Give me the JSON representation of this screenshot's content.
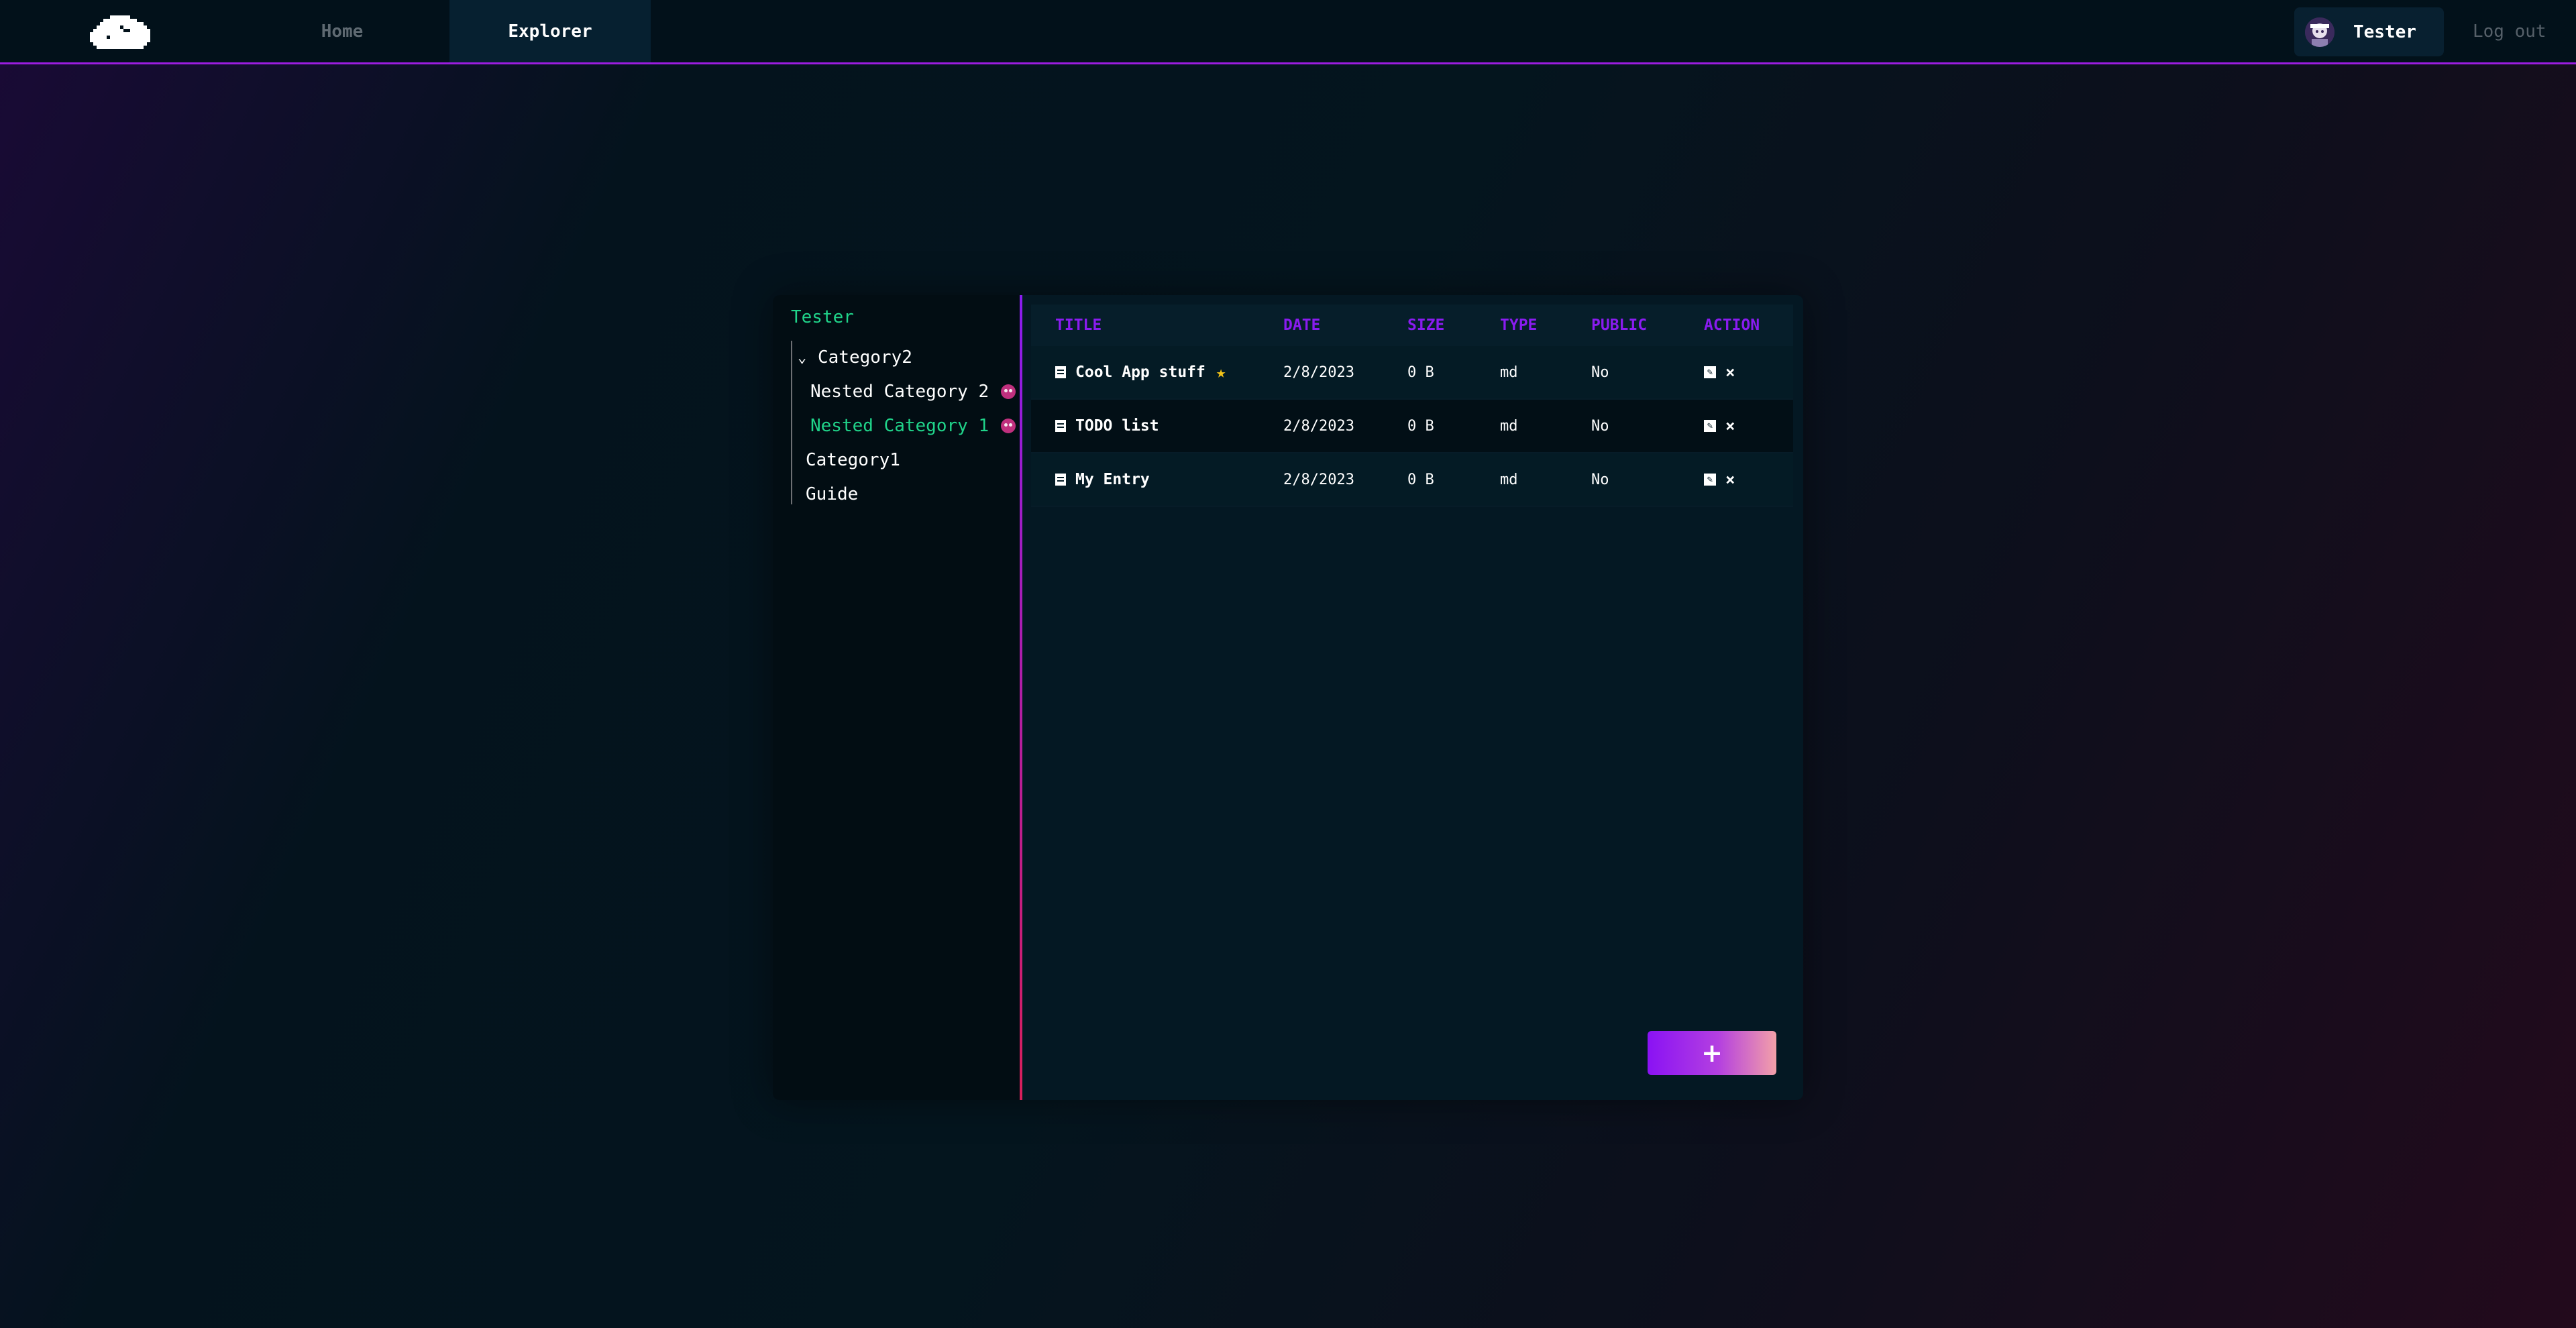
{
  "nav": {
    "tabs": [
      {
        "label": "Home",
        "active": false
      },
      {
        "label": "Explorer",
        "active": true
      }
    ],
    "user": {
      "name": "Tester"
    },
    "logout_label": "Log out"
  },
  "sidebar": {
    "root_label": "Tester",
    "items": [
      {
        "label": "Category2",
        "expanded": true,
        "level": 1
      },
      {
        "label": "Nested Category 2",
        "level": 2,
        "icon": "demon-icon",
        "active": false
      },
      {
        "label": "Nested Category 1",
        "level": 2,
        "icon": "demon-icon",
        "active": true
      },
      {
        "label": "Category1",
        "level": 1
      },
      {
        "label": "Guide",
        "level": 1
      }
    ]
  },
  "table": {
    "headers": [
      "TITLE",
      "DATE",
      "SIZE",
      "TYPE",
      "PUBLIC",
      "ACTION"
    ],
    "rows": [
      {
        "title": "Cool App stuff",
        "starred": true,
        "date": "2/8/2023",
        "size": "0 B",
        "type": "md",
        "public": "No"
      },
      {
        "title": "TODO list",
        "starred": false,
        "date": "2/8/2023",
        "size": "0 B",
        "type": "md",
        "public": "No"
      },
      {
        "title": "My Entry",
        "starred": false,
        "date": "2/8/2023",
        "size": "0 B",
        "type": "md",
        "public": "No"
      }
    ]
  },
  "add_button_label": "+",
  "colors": {
    "accent_purple": "#8a1cf0",
    "accent_green": "#20d48a",
    "star": "#f5c518"
  }
}
